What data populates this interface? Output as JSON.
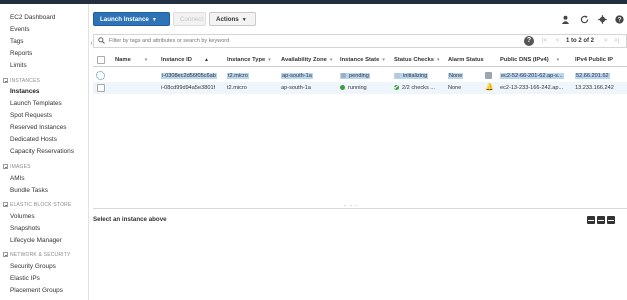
{
  "sidebar": {
    "items": [
      {
        "label": "EC2 Dashboard"
      },
      {
        "label": "Events"
      },
      {
        "label": "Tags"
      },
      {
        "label": "Reports"
      },
      {
        "label": "Limits"
      }
    ],
    "sections": [
      {
        "title": "INSTANCES",
        "items": [
          "Instances",
          "Launch Templates",
          "Spot Requests",
          "Reserved Instances",
          "Dedicated Hosts",
          "Capacity Reservations"
        ]
      },
      {
        "title": "IMAGES",
        "items": [
          "AMIs",
          "Bundle Tasks"
        ]
      },
      {
        "title": "ELASTIC BLOCK STORE",
        "items": [
          "Volumes",
          "Snapshots",
          "Lifecycle Manager"
        ]
      },
      {
        "title": "NETWORK & SECURITY",
        "items": [
          "Security Groups",
          "Elastic IPs",
          "Placement Groups"
        ]
      }
    ],
    "active": "Instances"
  },
  "toolbar": {
    "launch_label": "Launch Instance",
    "connect_label": "Connect",
    "actions_label": "Actions",
    "icons": [
      "user-icon",
      "refresh-icon",
      "gear-icon",
      "help-icon"
    ]
  },
  "filter": {
    "placeholder": "Filter by tags and attributes or search by keyword",
    "pager_text": "1 to 2 of 2"
  },
  "table": {
    "headers": [
      "Name",
      "Instance ID",
      "Instance Type",
      "Availability Zone",
      "Instance State",
      "Status Checks",
      "Alarm Status",
      "Public DNS (IPv4)",
      "IPv4 Public IP"
    ],
    "rows": [
      {
        "name": "",
        "instance_id": "i-0308ec2d56f05c6ab",
        "type": "t2.micro",
        "zone": "ap-south-1a",
        "state": "pending",
        "status": "initializing",
        "alarm": "None",
        "dns": "ec2-52-66-201-62.ap-s...",
        "ip": "52.66.201.62"
      },
      {
        "name": "",
        "instance_id": "i-08cd99d94a5e3801f",
        "type": "t2.micro",
        "zone": "ap-south-1a",
        "state": "running",
        "status": "2/2 checks ...",
        "alarm": "None",
        "dns": "ec2-13-233-166-242.ap...",
        "ip": "13.233.166.242"
      }
    ]
  },
  "details": {
    "title": "Select an instance above"
  },
  "colors": {
    "primary": "#2e73b8",
    "running": "#3c9b3c",
    "topbar": "#232f3e"
  }
}
